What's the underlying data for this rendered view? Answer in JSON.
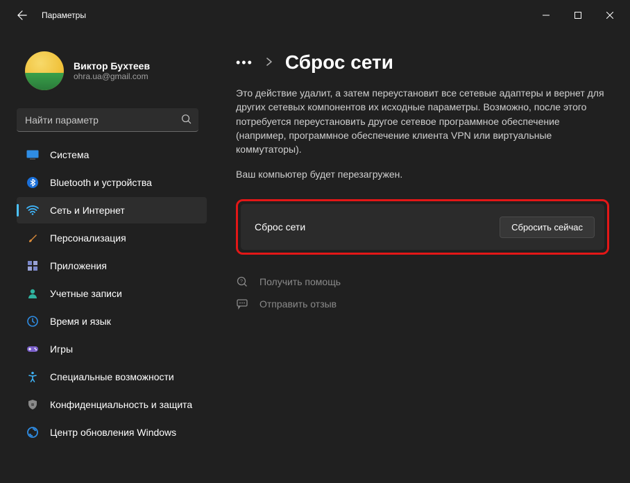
{
  "window": {
    "title": "Параметры"
  },
  "account": {
    "name": "Виктор Бухтеев",
    "email": "ohra.ua@gmail.com"
  },
  "search": {
    "placeholder": "Найти параметр"
  },
  "sidebar": {
    "items": [
      {
        "label": "Система",
        "icon": "system-icon",
        "color": "#2f8de4"
      },
      {
        "label": "Bluetooth и устройства",
        "icon": "bluetooth-icon",
        "color": "#1a6fd8"
      },
      {
        "label": "Сеть и Интернет",
        "icon": "wifi-icon",
        "color": "#3fb3f7",
        "active": true
      },
      {
        "label": "Персонализация",
        "icon": "brush-icon",
        "color": "#d98a3a"
      },
      {
        "label": "Приложения",
        "icon": "apps-icon",
        "color": "#7a87c9"
      },
      {
        "label": "Учетные записи",
        "icon": "account-icon",
        "color": "#2fb3a0"
      },
      {
        "label": "Время и язык",
        "icon": "clock-icon",
        "color": "#2f8de4"
      },
      {
        "label": "Игры",
        "icon": "games-icon",
        "color": "#7a5fc9"
      },
      {
        "label": "Специальные возможности",
        "icon": "accessibility-icon",
        "color": "#3fb3f7"
      },
      {
        "label": "Конфиденциальность и защита",
        "icon": "shield-icon",
        "color": "#8a8a8a"
      },
      {
        "label": "Центр обновления Windows",
        "icon": "update-icon",
        "color": "#2f8de4"
      }
    ]
  },
  "breadcrumb": {
    "title": "Сброс сети"
  },
  "main": {
    "description": "Это действие удалит, а затем переустановит все сетевые адаптеры и вернет для других сетевых компонентов их исходные параметры. Возможно, после этого потребуется переустановить другое сетевое программное обеспечение (например, программное обеспечение клиента VPN или виртуальные коммутаторы).",
    "restart_note": "Ваш компьютер будет перезагружен.",
    "reset_row_label": "Сброс сети",
    "reset_button": "Сбросить сейчас"
  },
  "help": {
    "get_help": "Получить помощь",
    "feedback": "Отправить отзыв"
  }
}
